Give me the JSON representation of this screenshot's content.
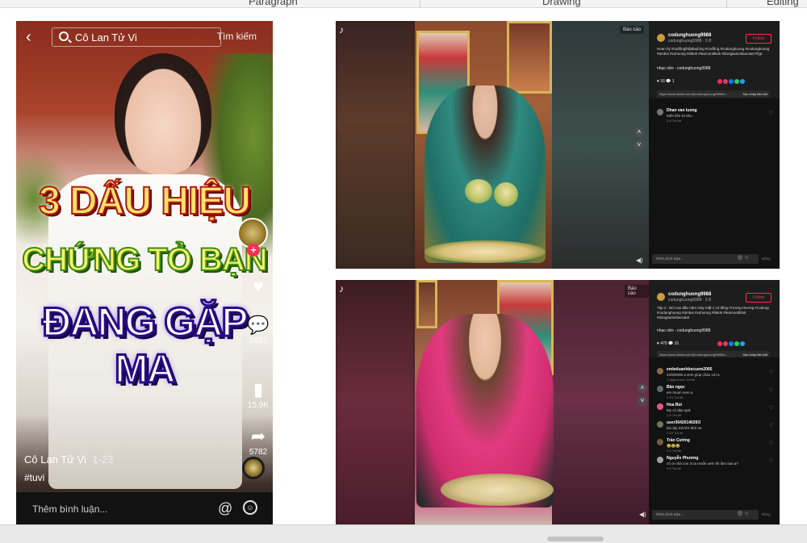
{
  "ribbon": {
    "groups": [
      "Paragraph",
      "Drawing",
      "Editing"
    ]
  },
  "left_phone": {
    "search_value": "Cô Lan Tử Vi",
    "search_button": "Tìm kiếm",
    "headline": [
      "3 DẤU HIỆU",
      "CHỨNG TỎ BẠN",
      "ĐANG GẶP MA"
    ],
    "counts": {
      "comments": "1651",
      "saves": "15,9K",
      "shares": "5782"
    },
    "author": "Cô Lan Tử Vi",
    "time": "1-23",
    "hashtag": "#tuvi",
    "comment_placeholder": "Thêm bình luận..."
  },
  "shot1": {
    "save_chip": "Báo cáo",
    "user": "codunghuong9988",
    "user_sub": "codunghuong9988 · 2-8",
    "follow": "Follow",
    "desc": "Hoan hỷ #cođồngthậtđaulòng #cođồng #codunghuong #codunghuong #ambai #xuhuong #tiktok #learnontiktok #dongiaolonlaocatal #fyp",
    "music": "nhạc nền - codunghuong9988",
    "stats": "♥ 16   💬 1",
    "link": "https://www.tiktok.com/@codunghuong9988/vi...",
    "copy": "Sao chép liên kết",
    "comments": [
      {
        "user": "Dhan van luong",
        "text": "Kiến liền ko khu",
        "meta": "2-8   Trả lời"
      }
    ],
    "input_placeholder": "Thêm bình luận...",
    "post": "Đăng"
  },
  "shot2": {
    "save_chip": "Báo cáo",
    "user": "codunghuong9988",
    "user_sub": "codunghuong9988 · 2-8",
    "follow": "Follow",
    "desc": "Tập 2 : Bói cau đầu năm may mắn | cô đồng Trương Hương #codong #codunghuong #ambai #xuhuong #tiktok #learnontiktok #dongiaolonlaocatal",
    "music": "nhạc nền - codunghuong9988",
    "stats": "♥ 470   💬 31",
    "link": "https://www.tiktok.com/@codunghuong9988/vi...",
    "copy": "Sao chép liên kết",
    "comments": [
      {
        "user": "embeluanhbecuem2005",
        "text": "22/9/2005 ạ xem giúp cháu với ạ",
        "meta": "1 ngày trước   Trả lời"
      },
      {
        "user": "Bảo ngọc",
        "text": "em muon xem ạ",
        "meta": "2-10   Trả lời"
      },
      {
        "user": "Hoa Bùi",
        "text": "tay cô đẹp quá",
        "meta": "2-9   Trả lời"
      },
      {
        "user": "user3642014026O",
        "text": "bà này mà lên thời ne",
        "meta": "2-10   Trả lời"
      },
      {
        "user": "Trần Cường",
        "text": "😂😂😂",
        "meta": "2-9   Trả lời"
      },
      {
        "user": "Nguyễn Phương",
        "text": "cô ơi nhà con 3 ca muốn xem thì làm sao ạ?",
        "meta": "2-9   Trả lời"
      }
    ],
    "input_placeholder": "Thêm bình luận...",
    "post": "Đăng"
  }
}
